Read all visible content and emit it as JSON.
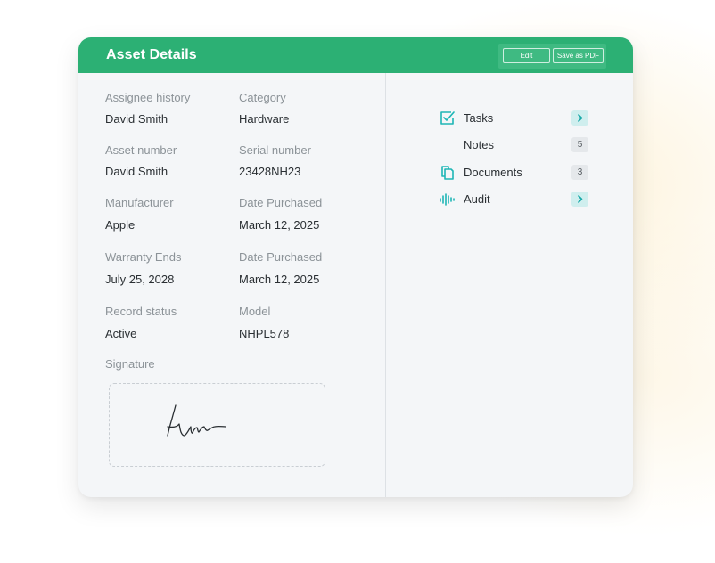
{
  "header": {
    "title": "Asset Details",
    "edit_label": "Edit",
    "save_pdf_label": "Save as PDF"
  },
  "fields": {
    "assignee_history": {
      "label": "Assignee history",
      "value": "David Smith"
    },
    "category": {
      "label": "Category",
      "value": "Hardware"
    },
    "asset_number": {
      "label": "Asset number",
      "value": "David Smith"
    },
    "serial_number": {
      "label": "Serial number",
      "value": "23428NH23"
    },
    "manufacturer": {
      "label": "Manufacturer",
      "value": "Apple"
    },
    "date_purchased_1": {
      "label": "Date Purchased",
      "value": "March 12, 2025"
    },
    "warranty_ends": {
      "label": "Warranty Ends",
      "value": "July 25, 2028"
    },
    "date_purchased_2": {
      "label": "Date Purchased",
      "value": "March 12, 2025"
    },
    "record_status": {
      "label": "Record status",
      "value": "Active"
    },
    "model": {
      "label": "Model",
      "value": "NHPL578"
    },
    "signature": {
      "label": "Signature"
    }
  },
  "side_nav": {
    "items": [
      {
        "label": "Tasks",
        "icon": "checkbox-icon",
        "badge": ""
      },
      {
        "label": "Notes",
        "icon": "",
        "badge": "5"
      },
      {
        "label": "Documents",
        "icon": "documents-icon",
        "badge": "3"
      },
      {
        "label": "Audit",
        "icon": "waveform-icon",
        "badge": ""
      }
    ]
  },
  "colors": {
    "header": "#2cb074",
    "accent_teal": "#1eb6b6",
    "card_background": "#f4f6f8"
  }
}
